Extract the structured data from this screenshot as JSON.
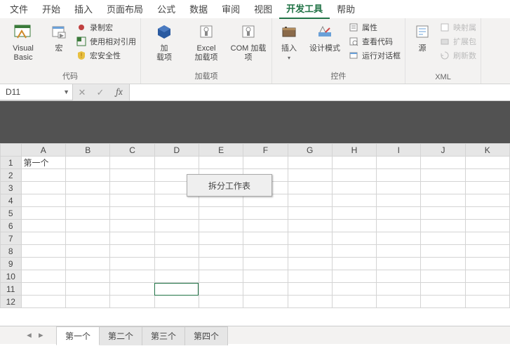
{
  "menu": {
    "tabs": [
      "文件",
      "开始",
      "插入",
      "页面布局",
      "公式",
      "数据",
      "审阅",
      "视图",
      "开发工具",
      "帮助"
    ],
    "active_index": 8
  },
  "ribbon": {
    "groups": [
      {
        "label": "代码",
        "big": [
          {
            "name": "visual-basic-button",
            "label": "Visual Basic"
          },
          {
            "name": "macros-button",
            "label": "宏"
          }
        ],
        "small": [
          {
            "name": "record-macro-item",
            "label": "录制宏"
          },
          {
            "name": "use-relative-ref-item",
            "label": "使用相对引用"
          },
          {
            "name": "macro-security-item",
            "label": "宏安全性"
          }
        ]
      },
      {
        "label": "加载项",
        "big": [
          {
            "name": "addins-button",
            "label": "加\n载项"
          },
          {
            "name": "excel-addins-button",
            "label": "Excel\n加载项"
          },
          {
            "name": "com-addins-button",
            "label": "COM 加载项"
          }
        ],
        "small": []
      },
      {
        "label": "控件",
        "big": [
          {
            "name": "insert-control-button",
            "label": "插入"
          },
          {
            "name": "design-mode-button",
            "label": "设计模式"
          }
        ],
        "small": [
          {
            "name": "properties-item",
            "label": "属性"
          },
          {
            "name": "view-code-item",
            "label": "查看代码"
          },
          {
            "name": "run-dialog-item",
            "label": "运行对话框"
          }
        ]
      },
      {
        "label": "XML",
        "big": [
          {
            "name": "source-button",
            "label": "源"
          }
        ],
        "small": [
          {
            "name": "map-properties-item",
            "label": "映射属"
          },
          {
            "name": "expansion-pack-item",
            "label": "扩展包"
          },
          {
            "name": "refresh-data-item",
            "label": "刷新数"
          }
        ]
      }
    ]
  },
  "formula_bar": {
    "name_box": "D11",
    "cancel": "✕",
    "enter": "✓",
    "fx": "fx",
    "value": ""
  },
  "grid": {
    "cols": [
      "A",
      "B",
      "C",
      "D",
      "E",
      "F",
      "G",
      "H",
      "I",
      "J",
      "K"
    ],
    "rows": 12,
    "cells": {
      "A1": "第一个"
    },
    "selected": "D11"
  },
  "form_button": {
    "label": "拆分工作表"
  },
  "sheets": {
    "tabs": [
      "第一个",
      "第二个",
      "第三个",
      "第四个"
    ],
    "active_index": 0
  }
}
